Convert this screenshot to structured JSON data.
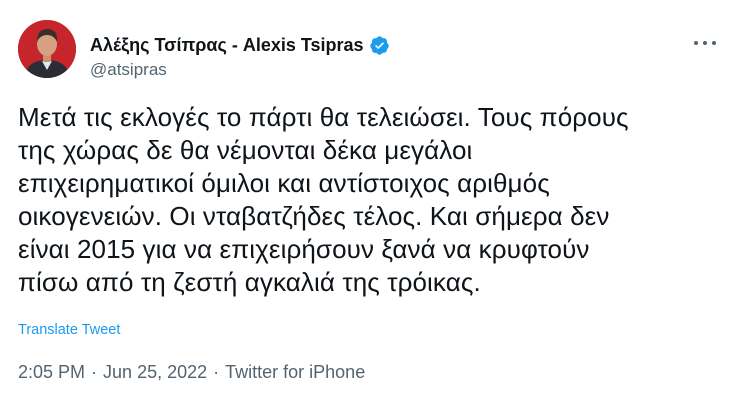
{
  "author": {
    "display_name": "Αλέξης Τσίπρας - Alexis Tsipras",
    "handle": "@atsipras",
    "verified": true,
    "avatar_bg": "#c6262b"
  },
  "tweet": {
    "lines": [
      "Μετά τις εκλογές το πάρτι θα τελειώσει. Τους πόρους",
      "της χώρας δε θα νέμονται δέκα μεγάλοι",
      "επιχειρηματικοί όμιλοι και αντίστοιχος αριθμός",
      "οικογενειών. Οι νταβατζήδες τέλος. Και σήμερα δεν",
      "είναι 2015 για να επιχειρήσουν ξανά να κρυφτούν",
      "πίσω από τη ζεστή αγκαλιά της τρόικας."
    ],
    "translate_label": "Translate Tweet"
  },
  "meta": {
    "time": "2:05 PM",
    "date": "Jun 25, 2022",
    "separator": "·",
    "source": "Twitter for iPhone"
  },
  "colors": {
    "accent": "#1d9bf0",
    "secondary_text": "#536471",
    "primary_text": "#0f1419"
  }
}
